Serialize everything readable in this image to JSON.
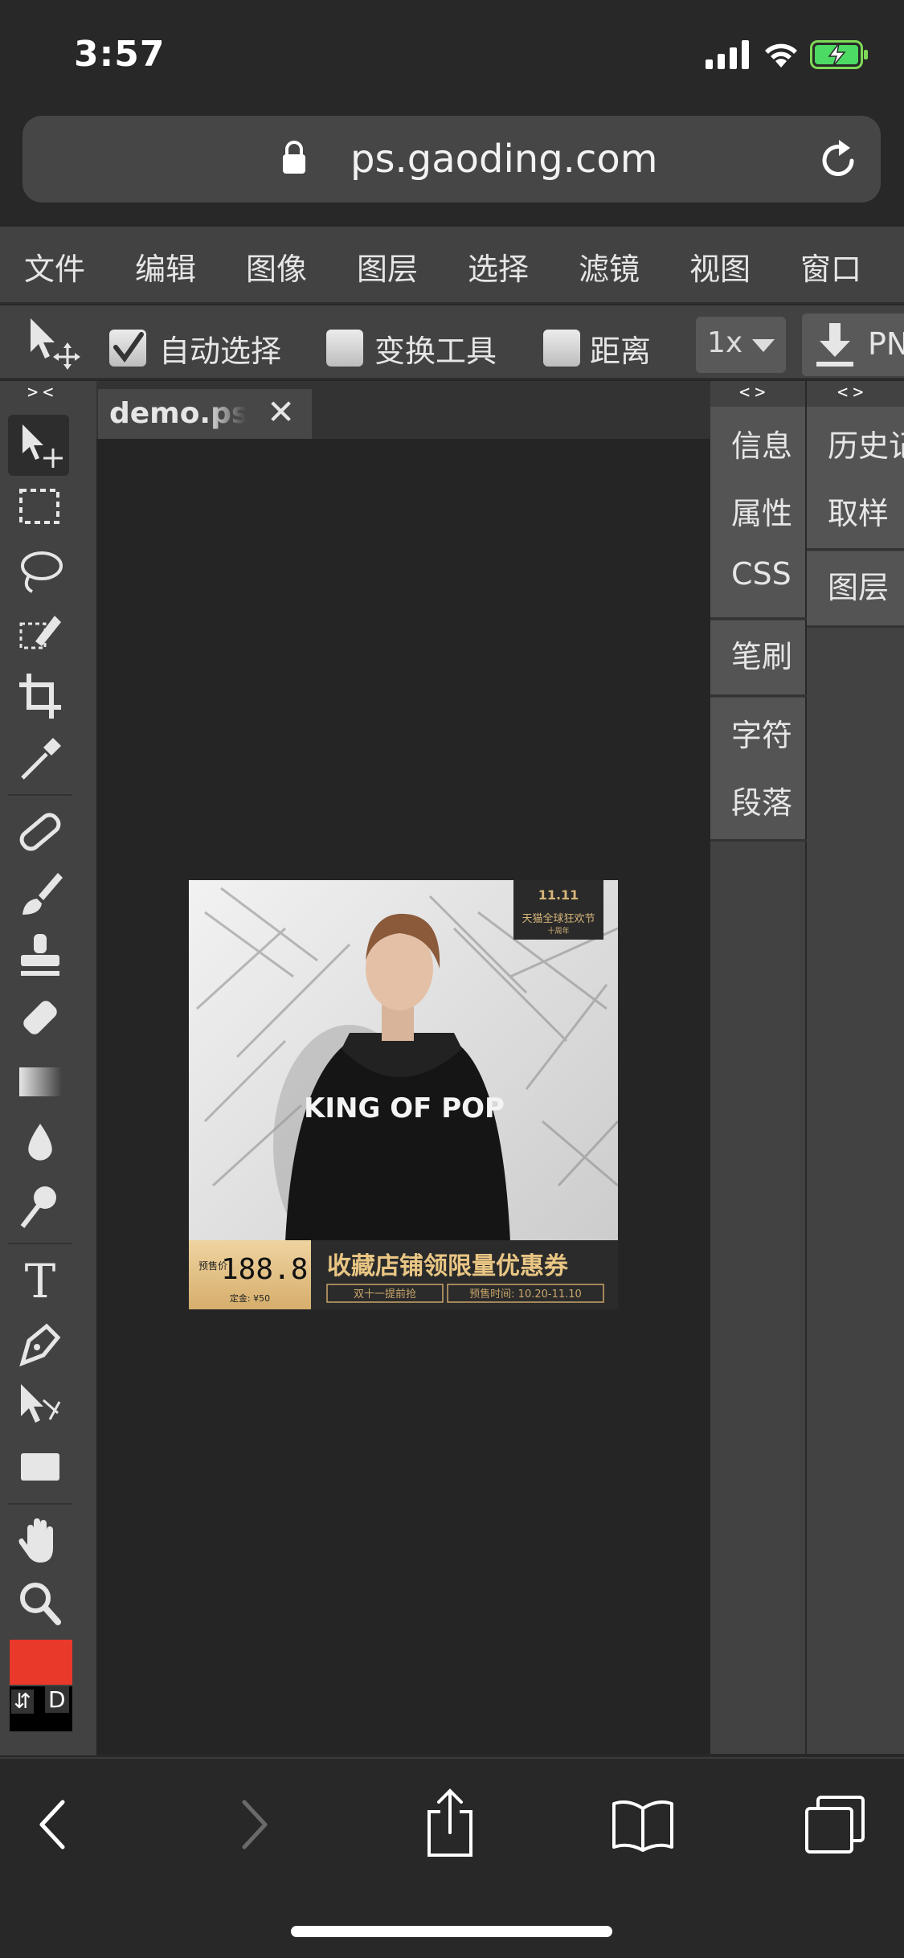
{
  "status_bar": {
    "time": "3:57"
  },
  "browser": {
    "url": "ps.gaoding.com"
  },
  "menu": {
    "items": [
      "文件",
      "编辑",
      "图像",
      "图层",
      "选择",
      "滤镜",
      "视图",
      "窗口"
    ]
  },
  "options": {
    "auto_select_label": "自动选择",
    "auto_select_checked": true,
    "transform_label": "变换工具",
    "distance_label": "距离",
    "zoom_value": "1x",
    "export_label": "PNG"
  },
  "panel_toggles": {
    "left": "><",
    "right1": "<>",
    "right2": "<>"
  },
  "document": {
    "tab_label": "demo.psd",
    "close_glyph": "✕"
  },
  "canvas_ad": {
    "badge_line1": "11.11",
    "badge_line2": "天猫全球狂欢节",
    "badge_line3": "十周年",
    "shirt_text": "KING OF POP",
    "presale_label": "预售价",
    "price": "188.8",
    "deposit": "定金: ¥50",
    "headline": "收藏店铺领限量优惠券",
    "tag1": "双十一提前抢",
    "tag2": "预售时间: 10.20-11.10"
  },
  "right_panel_1": {
    "groups": [
      [
        "信息",
        "属性",
        "CSS"
      ],
      [
        "笔刷"
      ],
      [
        "字符",
        "段落"
      ]
    ]
  },
  "right_panel_2": {
    "groups": [
      [
        "历史记录",
        "取样"
      ],
      [
        "图层"
      ]
    ]
  },
  "colors": {
    "foreground": "#e8392b",
    "background": "#000000",
    "swap_glyph": "⇵",
    "default_label": "D"
  },
  "icons": {
    "lock": "lock-icon",
    "reload": "reload-icon",
    "move": "move-tool-icon",
    "back": "back-icon",
    "forward": "forward-icon",
    "share": "share-icon",
    "bookmarks": "bookmarks-icon",
    "tabs": "tabs-icon"
  }
}
